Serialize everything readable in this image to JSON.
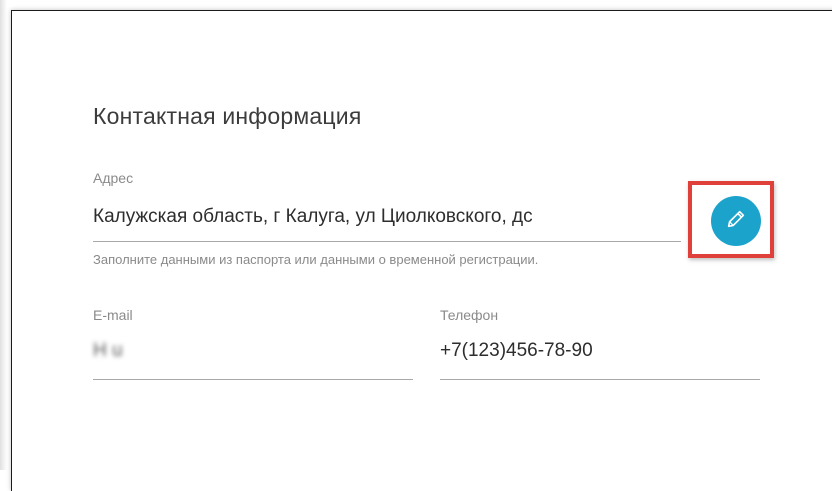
{
  "section": {
    "title": "Контактная информация"
  },
  "address": {
    "label": "Адрес",
    "value": "Калужская область, г Калуга, ул Циолковского, дс",
    "hint": "Заполните данными из паспорта или данными о временной регистрации.",
    "edit_icon": "pencil-icon"
  },
  "email": {
    "label": "E-mail",
    "value": "H                              u"
  },
  "phone": {
    "label": "Телефон",
    "value": "+7(123)456-78-90"
  },
  "colors": {
    "accent": "#1ba3cc",
    "highlight": "#e0403a",
    "text": "#2d2d2d",
    "muted": "#8a8a8a"
  }
}
